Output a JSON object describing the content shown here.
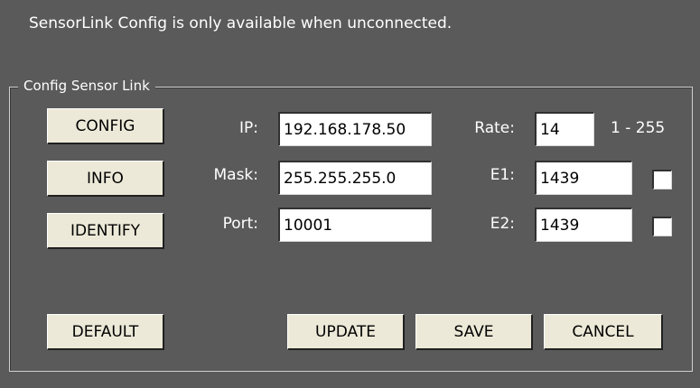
{
  "notice": "SensorLink Config is only available when unconnected.",
  "group_title": "Config Sensor Link",
  "side_buttons": {
    "config": "CONFIG",
    "info": "INFO",
    "identify": "IDENTIFY",
    "default": "DEFAULT"
  },
  "network": {
    "ip_label": "IP:",
    "ip_value": "192.168.178.50",
    "mask_label": "Mask:",
    "mask_value": "255.255.255.0",
    "port_label": "Port:",
    "port_value": "10001"
  },
  "sensor": {
    "rate_label": "Rate:",
    "rate_value": "14",
    "rate_range": "1 - 255",
    "e1_label": "E1:",
    "e1_value": "1439",
    "e1_checked": false,
    "e2_label": "E2:",
    "e2_value": "1439",
    "e2_checked": false
  },
  "actions": {
    "update": "UPDATE",
    "save": "SAVE",
    "cancel": "CANCEL"
  }
}
